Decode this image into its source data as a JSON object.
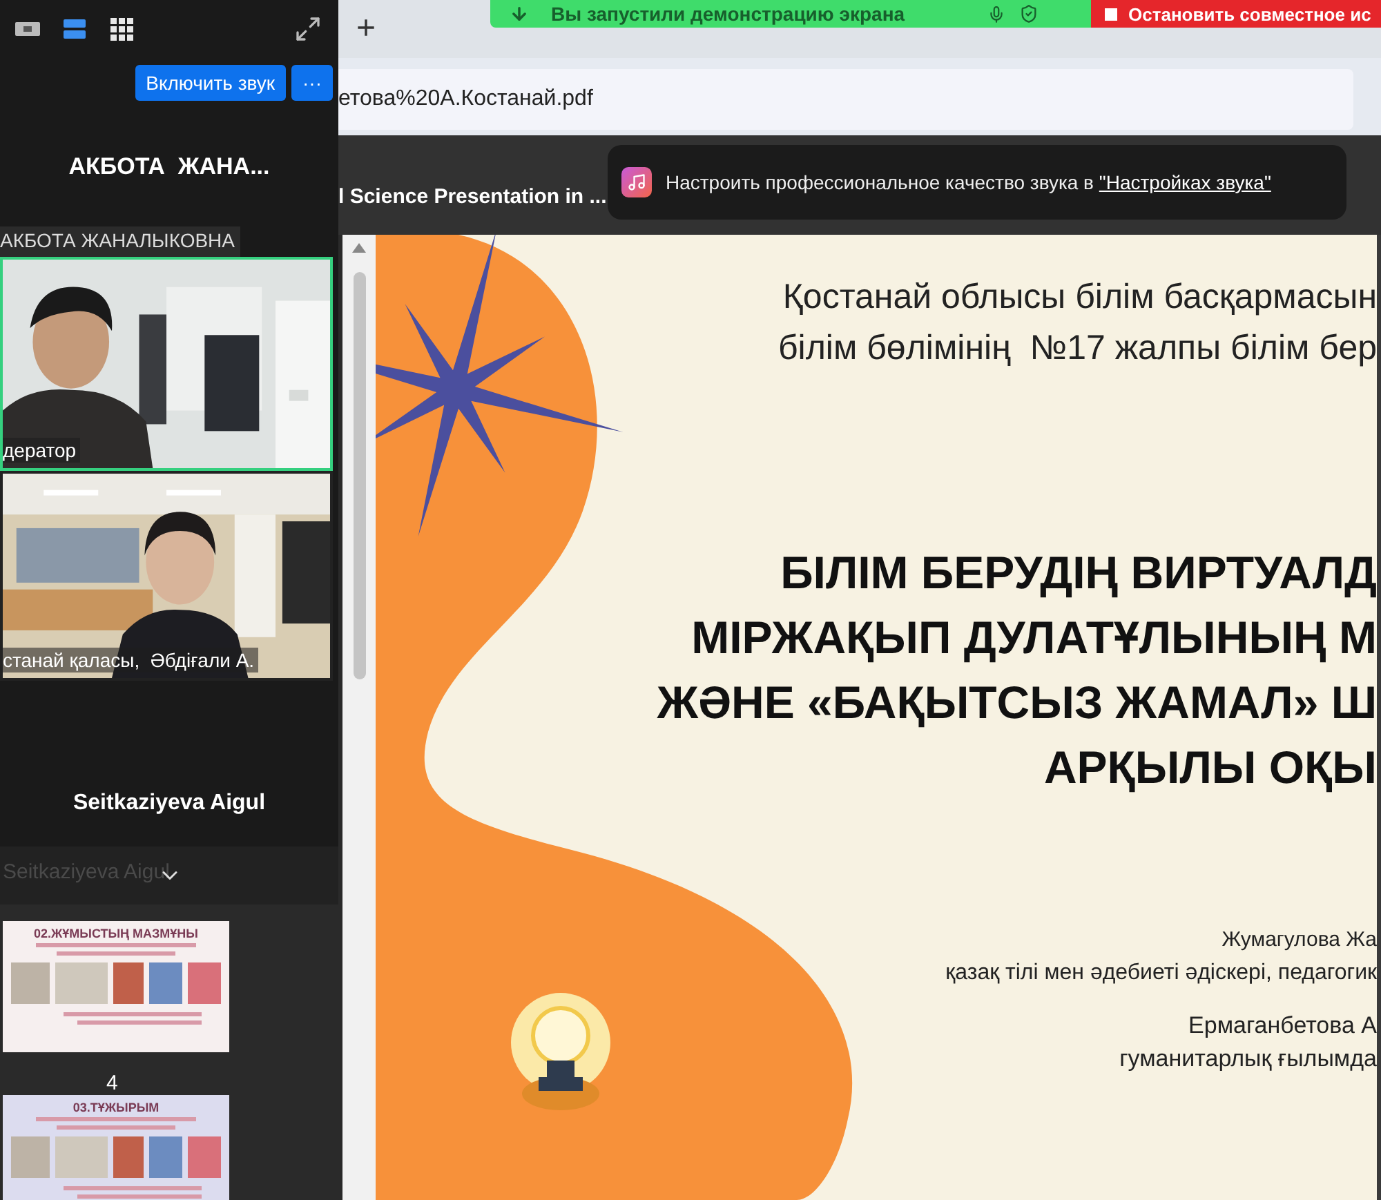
{
  "screen_share_bar": {
    "status": "Вы запустили демонстрацию экрана",
    "stop_button": "Остановить совместное ис"
  },
  "browser": {
    "new_tab": "+",
    "address": "етова%20А.Костанай.pdf",
    "pdf_title": "l Science Presentation in ..."
  },
  "toast": {
    "text": "Настроить профессиональное качество звука в ",
    "link": "\"Настройках звука\""
  },
  "meeting_panel": {
    "view_modes": [
      {
        "kind": "speaker",
        "selected": false
      },
      {
        "kind": "list",
        "selected": true
      },
      {
        "kind": "grid",
        "selected": false
      }
    ],
    "unmute_button": "Включить звук",
    "more_button": "···",
    "active_speaker": "АКБОТА  ЖАНА...",
    "speaker_label": "АКБОТА ЖАНАЛЫКОВНА",
    "tiles": [
      {
        "kind": "video",
        "label": "дератор",
        "highlighted": true
      },
      {
        "kind": "video",
        "label": "станай қаласы,  Әбдіғали А.",
        "highlighted": false
      },
      {
        "kind": "name",
        "name": "Seitkaziyeva Aigul",
        "highlighted": false
      }
    ],
    "footer_name": "Seitkaziyeva Aigul"
  },
  "thumbnails": [
    {
      "title": "02.ЖҰМЫСТЫҢ МАЗМҰНЫ",
      "page": "4"
    },
    {
      "title": "03.ТҰЖЫРЫМ"
    }
  ],
  "slide": {
    "header": [
      "Қостанай облысы білім басқармасын",
      "білім бөлімінің  №17 жалпы білім бер"
    ],
    "title": [
      "БІЛІМ БЕРУДІҢ ВИРТУАЛД",
      "МІРЖАҚЫП ДУЛАТҰЛЫНЫҢ М",
      "ЖӘНЕ «БАҚЫТСЫЗ ЖАМАЛ» Ш",
      "АРҚЫЛЫ ОҚЫ"
    ],
    "authors": [
      {
        "name": "Жумагулова Жа",
        "role": "қазақ тілі мен әдебиеті әдіскері, педагогик"
      },
      {
        "name": "Ермаганбетова А",
        "role": "гуманитарлық ғылымда"
      }
    ]
  }
}
